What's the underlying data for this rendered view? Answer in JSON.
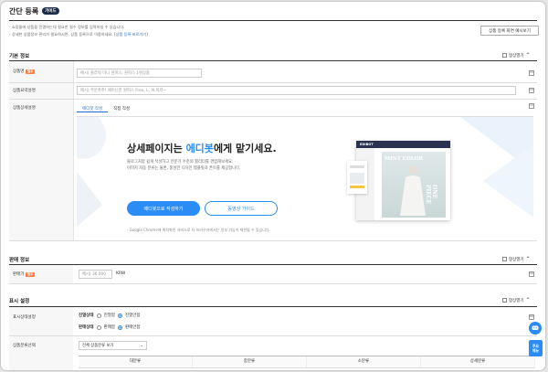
{
  "header": {
    "title": "간단 등록",
    "guide_badge": "가이드"
  },
  "notice": {
    "line1": "- 쇼핑몰에 상품을 진열하는데 필요한 필수 정보를 입력하실 수 있습니다.",
    "line2_prefix": "- 상세한 상품정보 관리가 필요하시면, 상품 등록으로 이용하세요. ",
    "line2_link": "[상품 등록 바로가기]",
    "example_button": "상품 등록 화면 예시보기"
  },
  "basic_section": {
    "title": "기본 정보",
    "collapse_label": "항상열기",
    "product_name_label": "상품명",
    "product_name_required": "필수",
    "product_name_placeholder": "예시) 플라워 미니 원피스, 원피스 1위상품",
    "summary_label": "상품요약설명",
    "summary_placeholder": "예시) 주문폭주! 페미닌한 원피스 Free, L, XL까지~",
    "detail_label": "상품상세설명",
    "tabs": [
      {
        "label": "에디봇 작성"
      },
      {
        "label": "직접 작성"
      }
    ],
    "headline_prefix": "상세페이지는 ",
    "headline_highlight": "에디봇",
    "headline_suffix": "에게 맡기세요.",
    "desc_line1": "블로그처럼 쉽게 작성하고 전문가 수준의 퀄리티를 경험해보세요.",
    "desc_line2": "이미지 자동 분류는 물론, 풍성한 디자인 템플릿과 폰트를 제공합니다.",
    "write_button": "에디봇으로 작성하기",
    "video_button": "동영상 가이드",
    "footnote": "- Google Chrome에 최적화된 서비스로 타 브라우저에서는 일부 기능이 제한될 수 있습니다.",
    "preview_brand": "EDIBOT",
    "preview_text1": "MINT COLOR",
    "preview_text2": "ONE PIECE"
  },
  "sale_section": {
    "title": "판매 정보",
    "collapse_label": "항상열기",
    "price_label": "판매가",
    "price_required": "필수",
    "price_placeholder": "예시) 36,000",
    "currency": "KRW"
  },
  "display_section": {
    "title": "표시 설정",
    "collapse_label": "항상열기",
    "status_label": "표시상태설정",
    "display_status_label": "진열상태",
    "display_options": [
      "진열함",
      "진열안함"
    ],
    "sale_status_label": "판매상태",
    "sale_options": [
      "판매함",
      "판매안함"
    ],
    "category_label": "상품분류선택",
    "category_select": "전체 상품분류 보기",
    "columns": [
      "대분류",
      "중분류",
      "소분류",
      "상세분류"
    ]
  },
  "floating": {
    "chat_label": "",
    "main_label": "주요\n메뉴"
  },
  "colors": {
    "accent": "#2b8cf5",
    "title_dark": "#1c2a4a",
    "required": "#ff7a3d"
  }
}
